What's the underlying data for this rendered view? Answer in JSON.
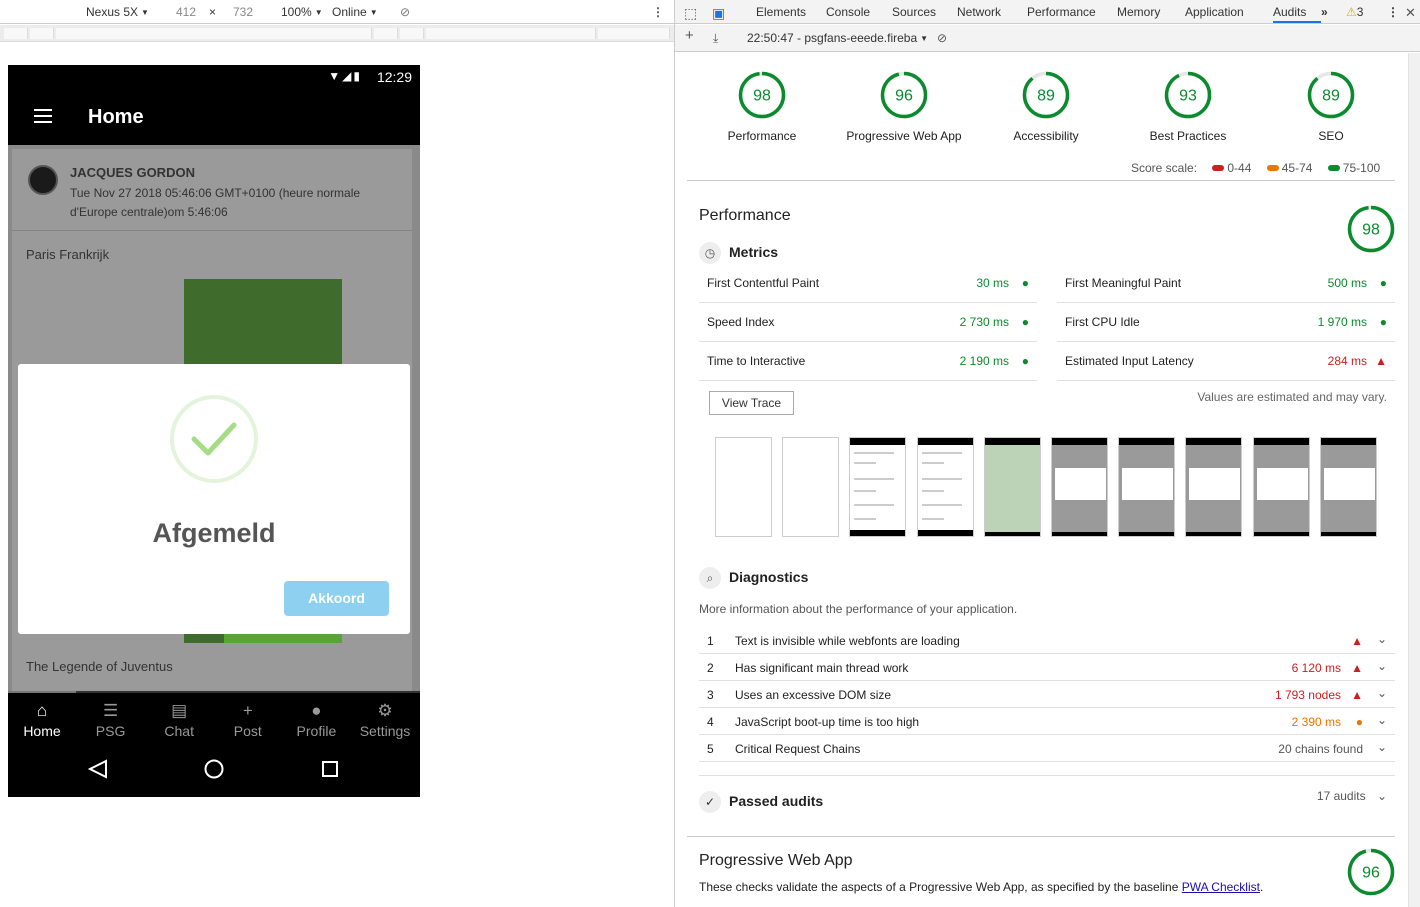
{
  "device_toolbar": {
    "device": "Nexus 5X",
    "width": "412",
    "times": "×",
    "height": "732",
    "zoom": "100%",
    "network": "Online"
  },
  "phone": {
    "status_time": "12:29",
    "app_title": "Home",
    "post": {
      "author": "JACQUES GORDON",
      "date": "Tue Nov 27 2018 05:46:06 GMT+0100 (heure normale d'Europe centrale)om 5:46:06",
      "title1": "Paris Frankrijk",
      "title2": "The Legende of Juventus"
    },
    "modal": {
      "message": "Afgemeld",
      "button": "Akkoord"
    },
    "tabs": [
      {
        "label": "Home",
        "icon": "home-icon"
      },
      {
        "label": "PSG",
        "icon": "list-icon"
      },
      {
        "label": "Chat",
        "icon": "chat-icon"
      },
      {
        "label": "Post",
        "icon": "plus-icon"
      },
      {
        "label": "Profile",
        "icon": "person-icon"
      },
      {
        "label": "Settings",
        "icon": "gear-icon"
      }
    ]
  },
  "devtools": {
    "tabs": [
      "Elements",
      "Console",
      "Sources",
      "Network",
      "Performance",
      "Memory",
      "Application",
      "Audits"
    ],
    "active_tab": "Audits",
    "warnings": "3",
    "report_selector": "22:50:47 - psgfans-eeede.fireba",
    "colors": {
      "pass": "#0b8a2e",
      "average": "#e67700",
      "fail": "#c7221f",
      "link": "#1a0dab",
      "accent": "#1a73e8"
    }
  },
  "scores": [
    {
      "label": "Performance",
      "value": 98
    },
    {
      "label": "Progressive Web App",
      "value": 96
    },
    {
      "label": "Accessibility",
      "value": 89
    },
    {
      "label": "Best Practices",
      "value": 93
    },
    {
      "label": "SEO",
      "value": 89
    }
  ],
  "score_scale": {
    "label": "Score scale:",
    "ranges": [
      "0-44",
      "45-74",
      "75-100"
    ]
  },
  "performance": {
    "title": "Performance",
    "score": 98,
    "metrics_title": "Metrics",
    "metrics": [
      {
        "name": "First Contentful Paint",
        "value": "30 ms",
        "status": "pass"
      },
      {
        "name": "First Meaningful Paint",
        "value": "500 ms",
        "status": "pass"
      },
      {
        "name": "Speed Index",
        "value": "2 730 ms",
        "status": "pass"
      },
      {
        "name": "First CPU Idle",
        "value": "1 970 ms",
        "status": "pass"
      },
      {
        "name": "Time to Interactive",
        "value": "2 190 ms",
        "status": "pass"
      },
      {
        "name": "Estimated Input Latency",
        "value": "284 ms",
        "status": "fail"
      }
    ],
    "view_trace": "View Trace",
    "estimate_note": "Values are estimated and may vary.",
    "diagnostics_title": "Diagnostics",
    "diagnostics_desc": "More information about the performance of your application.",
    "diagnostics": [
      {
        "n": "1",
        "text": "Text is invisible while webfonts are loading",
        "value": "",
        "status": "fail"
      },
      {
        "n": "2",
        "text": "Has significant main thread work",
        "value": "6 120 ms",
        "status": "fail"
      },
      {
        "n": "3",
        "text": "Uses an excessive DOM size",
        "value": "1 793 nodes",
        "status": "fail"
      },
      {
        "n": "4",
        "text": "JavaScript boot-up time is too high",
        "value": "2 390 ms",
        "status": "average"
      },
      {
        "n": "5",
        "text": "Critical Request Chains",
        "value": "20 chains found",
        "status": "info"
      }
    ],
    "passed_title": "Passed audits",
    "passed_count": "17 audits"
  },
  "pwa": {
    "title": "Progressive Web App",
    "score": 96,
    "desc": "These checks validate the aspects of a Progressive Web App, as specified by the baseline ",
    "link": "PWA Checklist",
    "desc_end": "."
  }
}
